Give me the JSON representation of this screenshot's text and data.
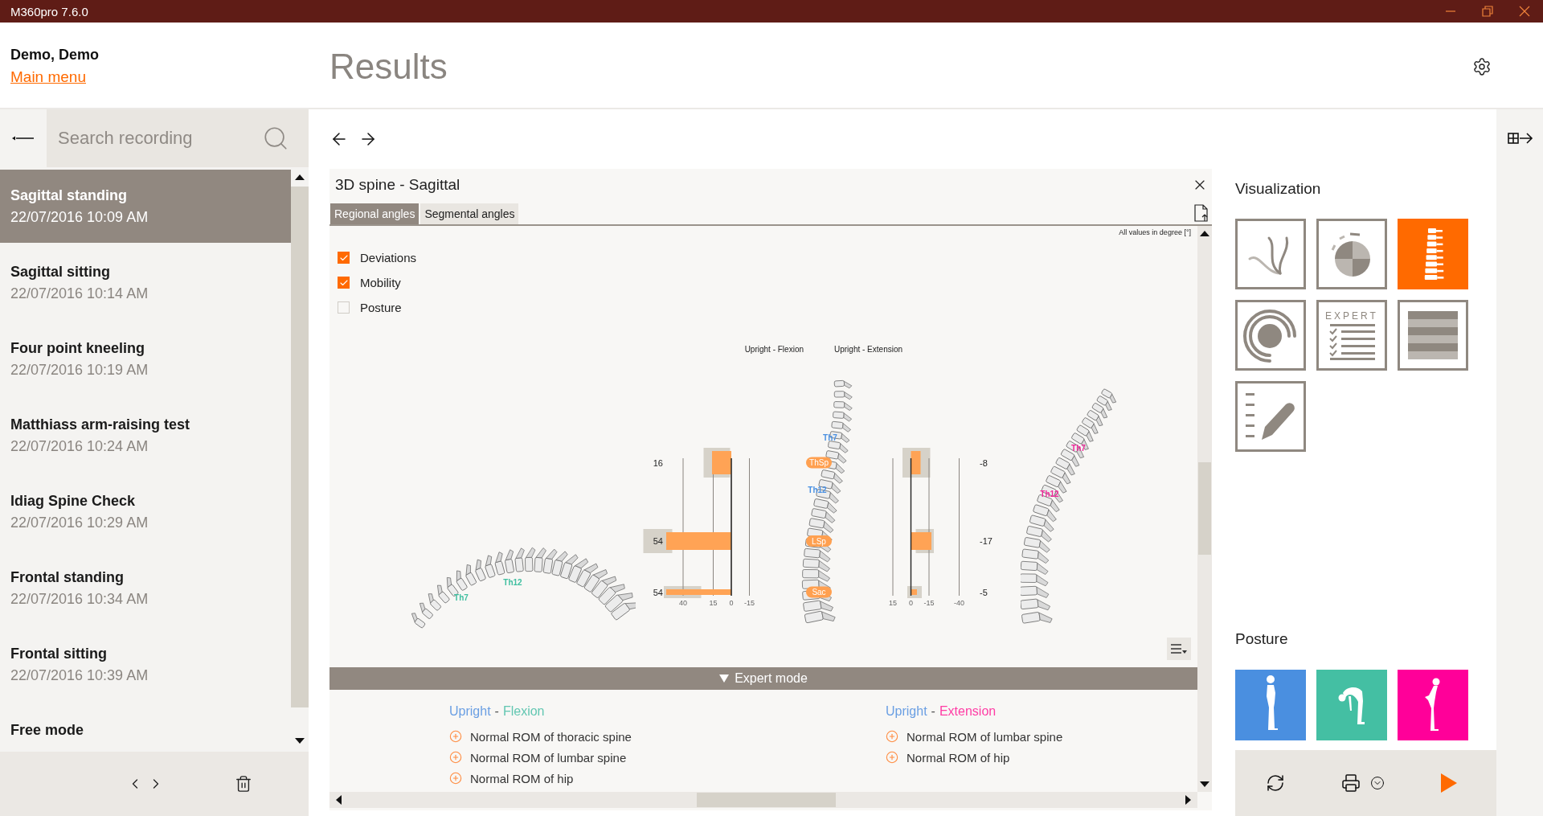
{
  "window": {
    "title": "M360pro 7.6.0"
  },
  "header": {
    "user": "Demo, Demo",
    "main_menu_link": "Main menu",
    "page_title": "Results"
  },
  "sidebar": {
    "search": {
      "placeholder": "Search recording"
    },
    "recordings": [
      {
        "name": "Sagittal standing",
        "date": "22/07/2016 10:09 AM",
        "selected": true
      },
      {
        "name": "Sagittal sitting",
        "date": "22/07/2016 10:14 AM",
        "selected": false
      },
      {
        "name": "Four point kneeling",
        "date": "22/07/2016 10:19 AM",
        "selected": false
      },
      {
        "name": "Matthiass arm-raising test",
        "date": "22/07/2016 10:24 AM",
        "selected": false
      },
      {
        "name": "Idiag Spine Check",
        "date": "22/07/2016 10:29 AM",
        "selected": false
      },
      {
        "name": "Frontal standing",
        "date": "22/07/2016 10:34 AM",
        "selected": false
      },
      {
        "name": "Frontal sitting",
        "date": "22/07/2016 10:39 AM",
        "selected": false
      },
      {
        "name": "Free mode",
        "selected": false
      }
    ]
  },
  "panel": {
    "title": "3D spine - Sagittal",
    "tabs": [
      {
        "label": "Regional angles",
        "selected": true
      },
      {
        "label": "Segmental angles",
        "selected": false
      }
    ],
    "units_note": "All values in degree [°]",
    "options": [
      {
        "label": "Deviations",
        "checked": true
      },
      {
        "label": "Mobility",
        "checked": true
      },
      {
        "label": "Posture",
        "checked": false
      }
    ],
    "spines": [
      {
        "kind": "flexion",
        "color": "#3fbfa0",
        "labels": [
          "Th7",
          "Th12"
        ]
      },
      {
        "kind": "upright",
        "color": "#4a90e2",
        "labels": [
          "Th7",
          "Th12"
        ],
        "badges": [
          "ThSp",
          "LSp",
          "Sac"
        ]
      },
      {
        "kind": "extension",
        "color": "#f0289a",
        "labels": [
          "Th7",
          "Th12"
        ]
      }
    ],
    "charts": [
      {
        "chart_data": {
          "type": "bar",
          "orientation": "horizontal",
          "title": "Upright - Flexion",
          "values": [
            16,
            54,
            54
          ],
          "xlim": [
            74,
            -15
          ],
          "xticks": [
            40,
            15,
            0,
            -15
          ],
          "grid": true,
          "data_labels": true,
          "bands": [
            {
              "axis": "x",
              "from": 1,
              "to": 23
            },
            {
              "axis": "x",
              "from": 49,
              "to": 73
            },
            {
              "axis": "x",
              "from": 25,
              "to": 56
            }
          ]
        }
      },
      {
        "chart_data": {
          "type": "bar",
          "orientation": "horizontal",
          "title": "Upright - Extension",
          "values": [
            -8,
            -17,
            -5
          ],
          "xlim": [
            15,
            -40
          ],
          "xticks": [
            15,
            0,
            -15,
            -40
          ],
          "ref_lines": [
            {
              "axis": "x",
              "value": -15
            }
          ],
          "bands": [
            {
              "axis": "x",
              "from": 7,
              "to": -16
            },
            {
              "axis": "x",
              "from": -4,
              "to": -19
            },
            {
              "axis": "x",
              "from": 3,
              "to": -9
            }
          ]
        },
        "readings": [
          "-8",
          "-17",
          "-5"
        ]
      }
    ],
    "expert_mode": {
      "label": "Expert mode",
      "expanded": true
    },
    "expert_columns": [
      {
        "heading": [
          {
            "text": "Upright",
            "color": "#6a9fe3"
          },
          {
            "text": "-",
            "color": "#555555"
          },
          {
            "text": "Flexion",
            "color": "#63c7b2"
          }
        ],
        "items": [
          "Normal ROM of thoracic spine",
          "Normal ROM of lumbar spine",
          "Normal ROM of hip"
        ]
      },
      {
        "heading": [
          {
            "text": "Upright",
            "color": "#6a9fe3"
          },
          {
            "text": "-",
            "color": "#555555"
          },
          {
            "text": "Extension",
            "color": "#ff3da5"
          }
        ],
        "items": [
          "Normal ROM of lumbar spine",
          "Normal ROM of hip"
        ]
      }
    ]
  },
  "visualization": {
    "title": "Visualization",
    "tiles": [
      {
        "kind": "curves",
        "selected": false
      },
      {
        "kind": "dial",
        "selected": false
      },
      {
        "kind": "spine",
        "selected": true
      },
      {
        "kind": "rings",
        "selected": false
      },
      {
        "kind": "expert",
        "label": "EXPERT",
        "selected": false
      },
      {
        "kind": "stripes",
        "selected": false
      },
      {
        "kind": "notes",
        "selected": false
      }
    ]
  },
  "posture": {
    "title": "Posture",
    "tiles": [
      {
        "kind": "upright",
        "color": "#4a8fe0"
      },
      {
        "kind": "flexion",
        "color": "#44bfa3"
      },
      {
        "kind": "extension",
        "color": "#ff0099"
      }
    ]
  }
}
